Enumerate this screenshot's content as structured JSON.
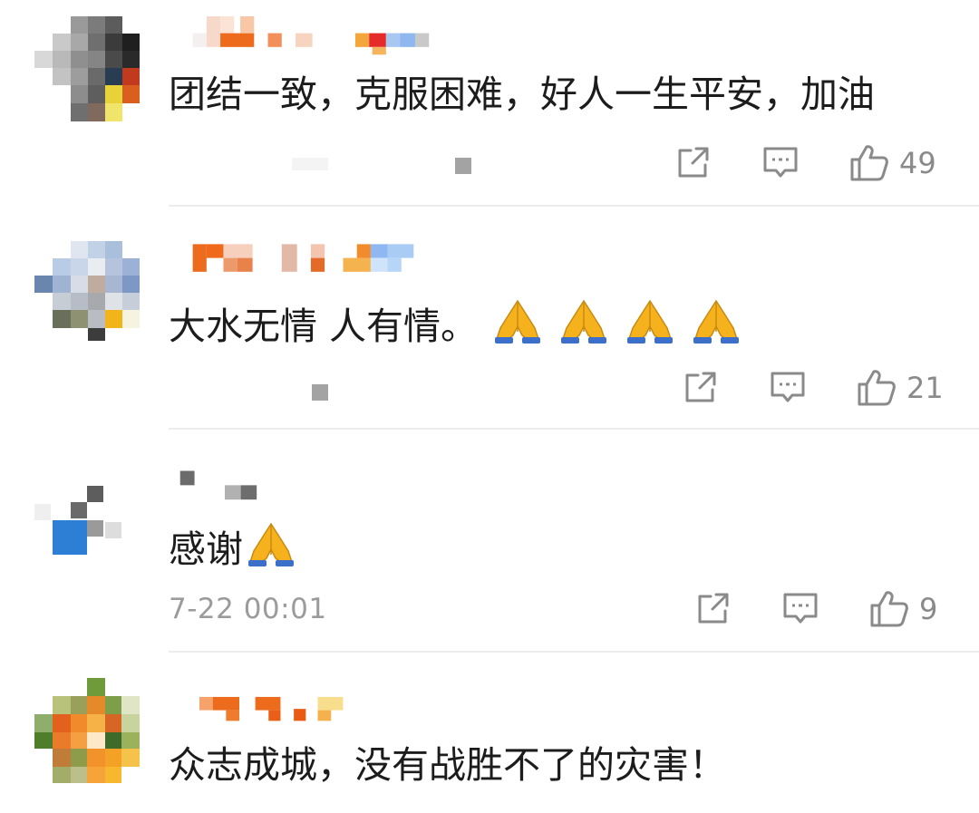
{
  "comments": [
    {
      "text": "团结一致，克服困难，好人一生平安，加油",
      "emoji_count": 0,
      "timestamp": "",
      "likes": "49"
    },
    {
      "text": "大水无情 人有情。",
      "emoji_count": 4,
      "timestamp": "",
      "likes": "21"
    },
    {
      "text": "感谢",
      "emoji_count": 1,
      "timestamp": "7-22 00:01",
      "likes": "9"
    },
    {
      "text": "众志成城，没有战胜不了的灾害！",
      "emoji_count": 0,
      "timestamp": "",
      "likes": ""
    }
  ],
  "icons": {
    "share": "share-icon",
    "reply": "comment-icon",
    "like": "thumbs-up-icon",
    "emoji": "folded-hands-emoji"
  },
  "colors": {
    "icon_gray": "#8a8a8a",
    "divider": "#ececec",
    "timestamp_gray": "#9b9b9b"
  }
}
